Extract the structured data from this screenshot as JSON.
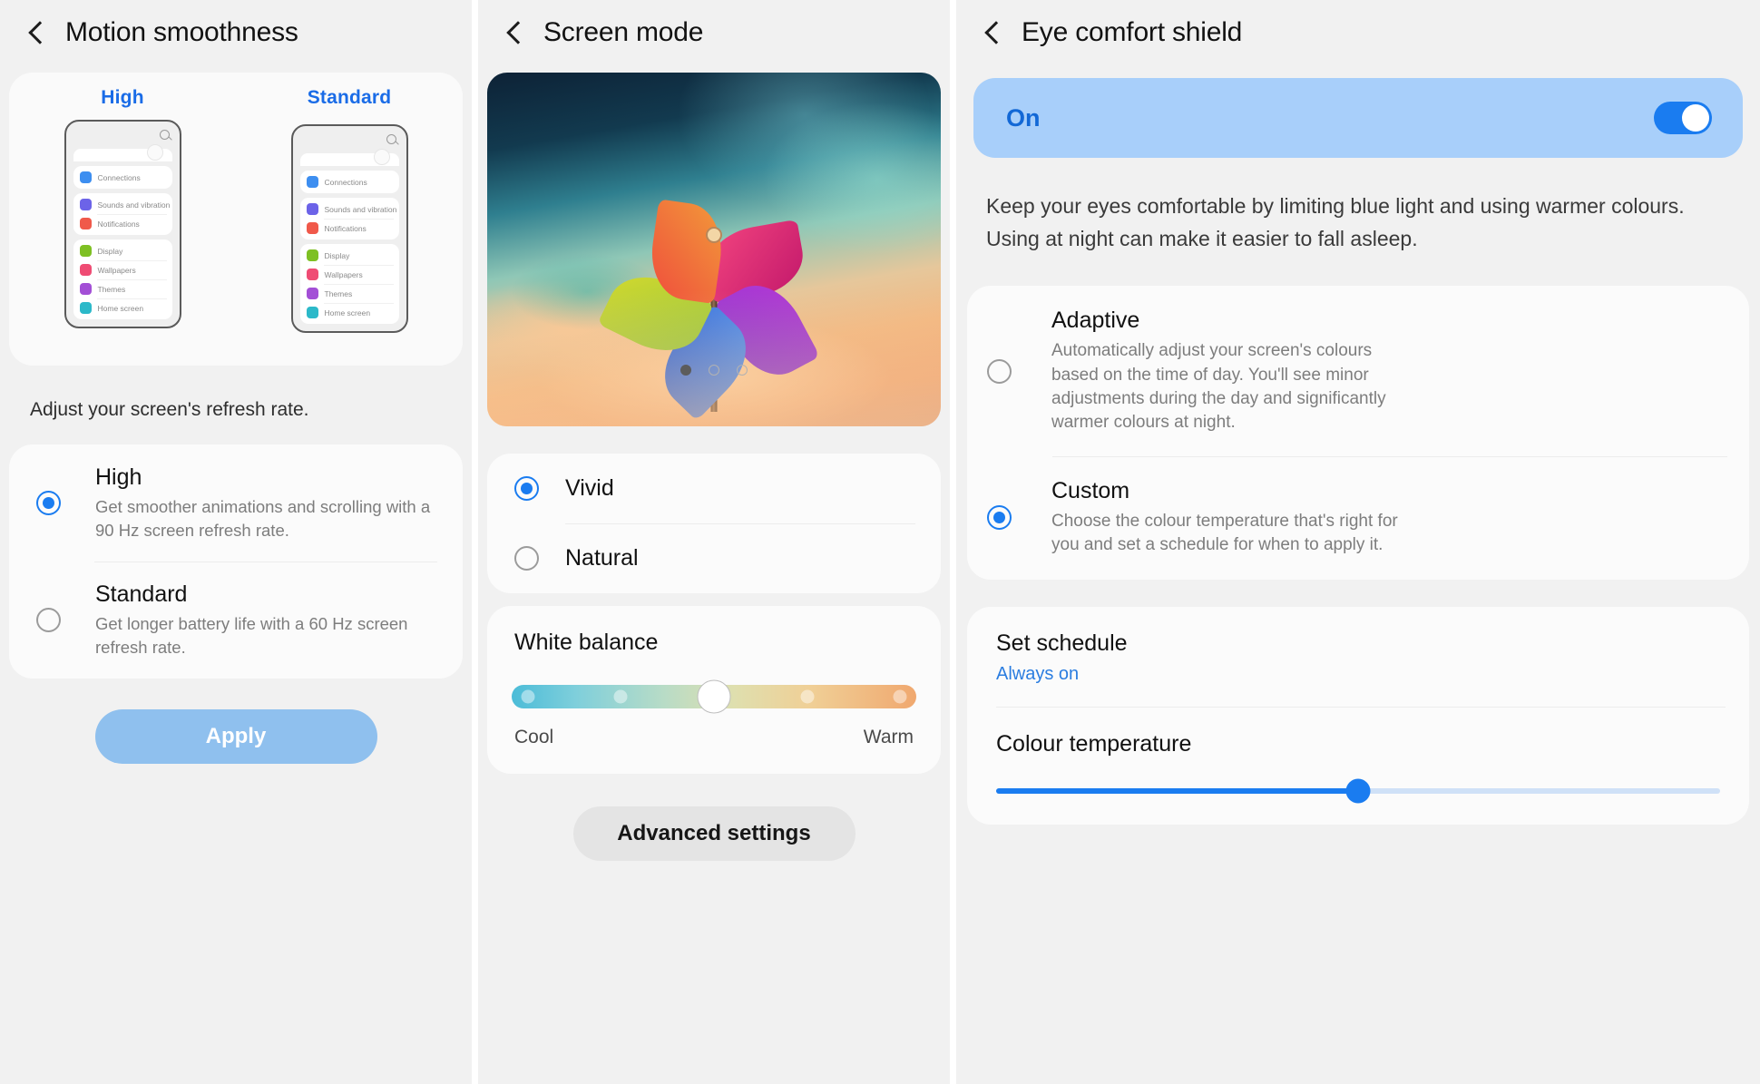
{
  "panel_motion": {
    "title": "Motion smoothness",
    "back_icon": "back-chevron-icon",
    "preview": {
      "columns": [
        {
          "label": "High",
          "menu_items": [
            {
              "label": "Connections",
              "color": "#3d8ef0"
            },
            {
              "label": "Sounds and vibration",
              "color": "#6c63e8"
            },
            {
              "label": "Notifications",
              "color": "#f0594a"
            },
            {
              "label": "Display",
              "color": "#7ec023"
            },
            {
              "label": "Wallpapers",
              "color": "#ef4c74"
            },
            {
              "label": "Themes",
              "color": "#a34fd6"
            },
            {
              "label": "Home screen",
              "color": "#2cb9c9"
            }
          ]
        },
        {
          "label": "Standard",
          "menu_items": [
            {
              "label": "Connections",
              "color": "#3d8ef0"
            },
            {
              "label": "Sounds and vibration",
              "color": "#6c63e8"
            },
            {
              "label": "Notifications",
              "color": "#f0594a"
            },
            {
              "label": "Display",
              "color": "#7ec023"
            },
            {
              "label": "Wallpapers",
              "color": "#ef4c74"
            },
            {
              "label": "Themes",
              "color": "#a34fd6"
            },
            {
              "label": "Home screen",
              "color": "#2cb9c9"
            }
          ]
        }
      ]
    },
    "description": "Adjust your screen's refresh rate.",
    "options": [
      {
        "title": "High",
        "subtitle": "Get smoother animations and scrolling with a 90 Hz screen refresh rate.",
        "selected": true
      },
      {
        "title": "Standard",
        "subtitle": "Get longer battery life with a 60 Hz screen refresh rate.",
        "selected": false
      }
    ],
    "apply_label": "Apply"
  },
  "panel_screen_mode": {
    "title": "Screen mode",
    "back_icon": "back-chevron-icon",
    "pager": {
      "total": 3,
      "active_index": 0
    },
    "modes": [
      {
        "label": "Vivid",
        "selected": true
      },
      {
        "label": "Natural",
        "selected": false
      }
    ],
    "white_balance": {
      "title": "White balance",
      "left_label": "Cool",
      "right_label": "Warm",
      "value_percent": 50
    },
    "advanced_label": "Advanced settings"
  },
  "panel_eye_comfort": {
    "title": "Eye comfort shield",
    "back_icon": "back-chevron-icon",
    "toggle": {
      "label": "On",
      "state": "on"
    },
    "description": "Keep your eyes comfortable by limiting blue light and using warmer colours. Using at night can make it easier to fall asleep.",
    "options": [
      {
        "title": "Adaptive",
        "subtitle": "Automatically adjust your screen's colours based on the time of day. You'll see minor adjustments during the day and significantly warmer colours at night.",
        "selected": false
      },
      {
        "title": "Custom",
        "subtitle": "Choose the colour temperature that's right for you and set a schedule for when to apply it.",
        "selected": true
      }
    ],
    "set_schedule": {
      "title": "Set schedule",
      "value": "Always on"
    },
    "colour_temperature": {
      "title": "Colour temperature",
      "value_percent": 50
    }
  },
  "colors": {
    "accent_blue": "#1a7cf0",
    "label_blue": "#1a6ce7",
    "apply_bg": "#8fc0ee",
    "toggle_bg": "#a8cffa",
    "panel_bg": "#f1f1f1",
    "card_bg": "#fbfbfb"
  }
}
